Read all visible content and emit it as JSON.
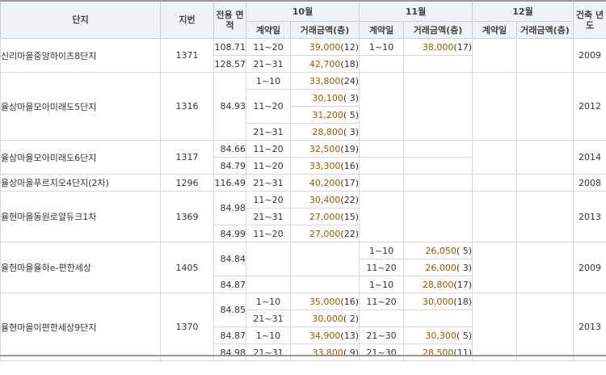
{
  "header": {
    "complex": "단지",
    "lot": "지번",
    "area": "전용 면적",
    "month1": "10월",
    "month2": "11월",
    "month3": "12월",
    "built": "건축 년도",
    "contract_day": "계약일",
    "amount": "거래금액(층)"
  },
  "rows": [
    {
      "name": "신리마을중앙하이츠8단지",
      "lot": "1371",
      "area": "108.71",
      "d10": "11~20",
      "p10": "39,000",
      "f10": "(12)",
      "d11": "1~10",
      "p11": "38,000",
      "f11": "(17)",
      "d12": "",
      "p12": "",
      "f12": "",
      "year": "2009"
    },
    {
      "area": "128.57",
      "d10": "21~31",
      "p10": "42,700",
      "f10": "(18)"
    },
    {
      "name": "율상마을모아미래도5단지",
      "lot": "1316",
      "area": "84.93",
      "d10": "1~10",
      "p10": "33,800",
      "f10": "(24)",
      "year": "2012"
    },
    {
      "d10": "11~20",
      "p10": "30,100",
      "f10": "( 3)"
    },
    {
      "p10": "31,200",
      "f10": "( 5)"
    },
    {
      "d10": "21~31",
      "p10": "28,800",
      "f10": "( 3)"
    },
    {
      "name": "율상마을모아미래도6단지",
      "lot": "1317",
      "area": "84.66",
      "d10": "11~20",
      "p10": "32,500",
      "f10": "(19)",
      "year": "2014"
    },
    {
      "area": "84.79",
      "d10": "11~20",
      "p10": "33,300",
      "f10": "(16)"
    },
    {
      "name": "율상마을푸르지오4단지(2차)",
      "lot": "1296",
      "area": "116.49",
      "d10": "21~31",
      "p10": "40,200",
      "f10": "(17)",
      "year": "2008"
    },
    {
      "name": "율현마을동원로얄듀크1차",
      "lot": "1369",
      "area": "84.98",
      "d10": "11~20",
      "p10": "30,400",
      "f10": "(22)",
      "year": "2013"
    },
    {
      "d10": "21~31",
      "p10": "27,000",
      "f10": "(15)"
    },
    {
      "area": "84.99",
      "d10": "11~20",
      "p10": "27,000",
      "f10": "(22)"
    },
    {
      "name": "율현마을율하e-편한세상",
      "lot": "1405",
      "area": "84.84",
      "d11": "1~10",
      "p11": "26,050",
      "f11": "( 5)",
      "year": "2009"
    },
    {
      "d11": "11~20",
      "p11": "26,000",
      "f11": "( 3)"
    },
    {
      "area": "84.87",
      "d11": "1~10",
      "p11": "28,800",
      "f11": "(17)"
    },
    {
      "name": "율현마을이편한세상9단지",
      "lot": "1370",
      "area": "84.85",
      "d10": "1~10",
      "p10": "35,000",
      "f10": "(16)",
      "d11": "11~20",
      "p11": "30,000",
      "f11": "(18)",
      "year": "2013"
    },
    {
      "d10": "21~31",
      "p10": "30,000",
      "f10": "( 2)"
    },
    {
      "area": "84.87",
      "d10": "1~10",
      "p10": "34,900",
      "f10": "(13)",
      "d11": "21~30",
      "p11": "30,300",
      "f11": "( 5)"
    },
    {
      "area": "84.98",
      "d10": "21~31",
      "p10": "33,800",
      "f10": "( 9)",
      "d11": "21~30",
      "p11": "28,500",
      "f11": "(11)"
    }
  ]
}
